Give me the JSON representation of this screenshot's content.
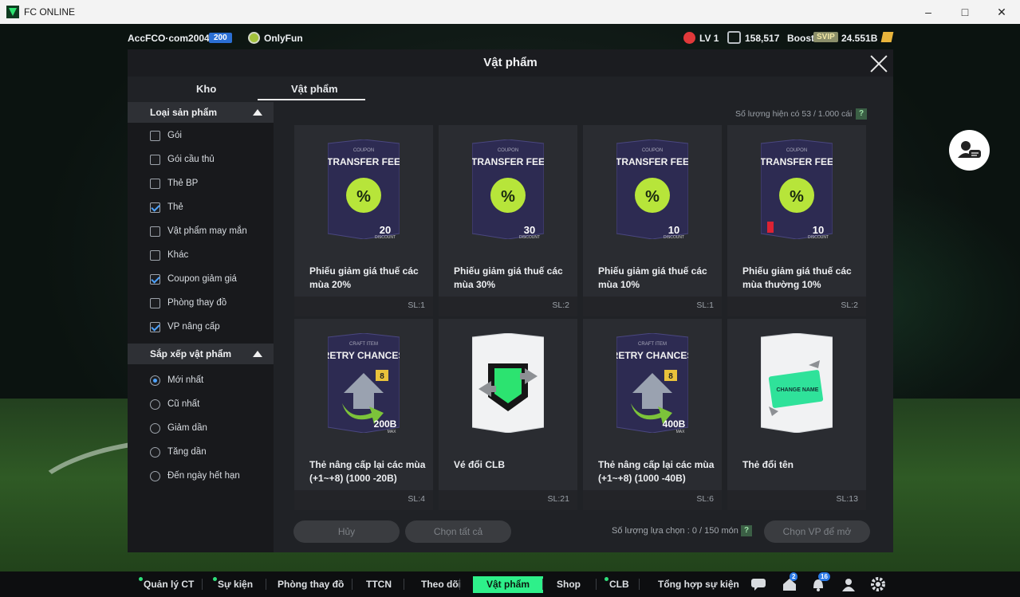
{
  "window": {
    "title": "FC ONLINE",
    "controls": [
      "minimize-icon",
      "maximize-icon",
      "close-icon"
    ]
  },
  "topbar": {
    "account": "AccFCO·com2004k",
    "account_level": "200",
    "club_name": "OnlyFun",
    "lv": "LV 1",
    "coins": "158,517",
    "boost": "Boost",
    "svip": "SVIP",
    "bp": "24.551B"
  },
  "modal": {
    "title": "Vật phẩm",
    "tabs": [
      {
        "label": "Kho"
      },
      {
        "label": "Vật phẩm"
      }
    ],
    "active_tab": "Vật phẩm",
    "quantity_text": "Số lượng hiện có  53 / 1.000 cái",
    "product_type": {
      "title": "Loại sản phẩm",
      "options": [
        {
          "label": "Gói",
          "checked": false
        },
        {
          "label": "Gói cầu thủ",
          "checked": false
        },
        {
          "label": "Thẻ BP",
          "checked": false
        },
        {
          "label": "Thẻ",
          "checked": true
        },
        {
          "label": "Vật phẩm may mắn",
          "checked": false
        },
        {
          "label": "Khác",
          "checked": false
        },
        {
          "label": "Coupon giảm giá",
          "checked": true
        },
        {
          "label": "Phòng thay đồ",
          "checked": false
        },
        {
          "label": "VP nâng cấp",
          "checked": true
        }
      ]
    },
    "sort": {
      "title": "Sắp xếp vật phẩm",
      "options": [
        {
          "label": "Mới nhất",
          "selected": true
        },
        {
          "label": "Cũ nhất",
          "selected": false
        },
        {
          "label": "Giảm dần",
          "selected": false
        },
        {
          "label": "Tăng dần",
          "selected": false
        },
        {
          "label": "Đến ngày hết hạn",
          "selected": false
        }
      ]
    },
    "items": [
      {
        "name": "Phiếu giảm giá thuế các mùa 20%",
        "sl": "SL:1",
        "kind": "coupon",
        "top": "COUPON",
        "head": "TRANSFER FEE",
        "pct": "20",
        "sub": "DISCOUNT"
      },
      {
        "name": "Phiếu giảm giá thuế các mùa 30%",
        "sl": "SL:2",
        "kind": "coupon",
        "top": "COUPON",
        "head": "TRANSFER FEE",
        "pct": "30",
        "sub": "DISCOUNT"
      },
      {
        "name": "Phiếu giảm giá thuế các mùa 10%",
        "sl": "SL:1",
        "kind": "coupon",
        "top": "COUPON",
        "head": "TRANSFER FEE",
        "pct": "10",
        "sub": "DISCOUNT"
      },
      {
        "name": "Phiếu giảm giá thuế các mùa thường 10%",
        "sl": "SL:2",
        "kind": "coupon",
        "top": "COUPON",
        "head": "TRANSFER FEE",
        "pct": "10",
        "sub": "DISCOUNT"
      },
      {
        "name": "Thẻ nâng cấp lại các mùa (+1~+8) (1000 -20B)",
        "sl": "SL:4",
        "kind": "retry",
        "top": "CRAFT ITEM",
        "head": "RETRY CHANCES",
        "value": "200B",
        "badge": "8",
        "sub": "MAX"
      },
      {
        "name": "Vé đổi CLB",
        "sl": "SL:21",
        "kind": "clb"
      },
      {
        "name": "Thẻ nâng cấp lại các mùa (+1~+8) (1000 -40B)",
        "sl": "SL:6",
        "kind": "retry",
        "top": "CRAFT ITEM",
        "head": "RETRY CHANCES",
        "value": "400B",
        "badge": "8",
        "sub": "MAX"
      },
      {
        "name": "Thẻ đổi tên",
        "sl": "SL:13",
        "kind": "rename",
        "label": "CHANGE NAME"
      }
    ],
    "cancel": "Hủy",
    "select_all": "Chọn tất cả",
    "selection_text": "Số lượng lựa chọn : 0 / 150 món",
    "choose_btn": "Chọn VP để mở",
    "help": "?"
  },
  "bottom_nav": [
    {
      "label": "Quản lý CT",
      "dot": true
    },
    {
      "label": "Sự kiện",
      "dot": true
    },
    {
      "label": "Phòng thay đồ",
      "dot": false
    },
    {
      "label": "TTCN",
      "dot": false
    },
    {
      "label": "Theo dõi",
      "dot": false
    },
    {
      "label": "Vật phẩm",
      "dot": false,
      "active": true
    },
    {
      "label": "Shop",
      "dot": false
    },
    {
      "label": "CLB",
      "dot": true
    },
    {
      "label": "Tổng hợp sự kiện",
      "dot": false
    }
  ],
  "bottom_icons": [
    {
      "name": "chat-icon"
    },
    {
      "name": "home-icon",
      "badge": "2"
    },
    {
      "name": "bell-icon",
      "badge": "16"
    },
    {
      "name": "profile-icon"
    },
    {
      "name": "settings-icon"
    }
  ],
  "colors": {
    "accent": "#2ef08a",
    "check": "#4ea3ff",
    "coupon_badge": "#b7e53a",
    "card_purple": "#2d2b52"
  }
}
